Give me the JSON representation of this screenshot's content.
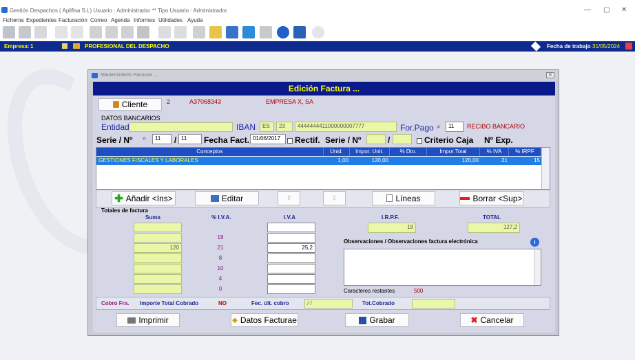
{
  "app": {
    "title": "Gestión Despachos  ( Aplifisa S.L)  Usuario : Administrador  **  Tipo Usuario : Administrador",
    "window_controls": [
      "—",
      "▢",
      "✕"
    ]
  },
  "menu": [
    "Ficheros",
    "Expedientes",
    "Facturación",
    "Correo",
    "Agenda",
    "Informes",
    "Utilidades",
    "Ayuda"
  ],
  "status": {
    "empresa_label": "Empresa:",
    "empresa_num": "1",
    "profesional": "PROFESIONAL DEL DESPACHO",
    "fecha_label": "Fecha de trabajo",
    "fecha_value": "31/05/2024"
  },
  "dialog": {
    "title": "Mantenimiento Facturas ...",
    "close": "✕",
    "header": "Edición Factura ..."
  },
  "cliente": {
    "button": "Cliente",
    "num": "2",
    "cif": "A37068343",
    "nombre": "EMPRESA X, SA"
  },
  "bank": {
    "section": "DATOS BANCARIOS",
    "entidad_label": "Entidad",
    "iban_label": "IBAN",
    "iban_country": "ES",
    "iban_check": "23",
    "iban_number": "4444444411000000007777",
    "forpago_label": "For.Pago",
    "forpago_code": "11",
    "forpago_desc": "RECIBO BANCARIO"
  },
  "serie": {
    "label": "Serie / Nº",
    "serie": "11",
    "num": "11",
    "fecha_label": "Fecha Fact.",
    "fecha": "01/06/2017",
    "rectif_label": "Rectif.",
    "serie2_label": "Serie / Nº",
    "criterio_label": "Criterio Caja",
    "nexp_label": "Nº Exp."
  },
  "table": {
    "headers": [
      "Conceptos",
      "Unid.",
      "Impor. Unit.",
      "% Dto.",
      "Impor.Total",
      "% IVA",
      "% IRPF"
    ],
    "rows": [
      {
        "concepto": "GESTIONES FISCALES Y LABORALES",
        "unid": "1,00",
        "unit": "120,00",
        "dto": "",
        "total": "120,00",
        "iva": "21",
        "irpf": "15"
      }
    ]
  },
  "buttons": {
    "anadir": "Añadir <Ins>",
    "editar": "Editar",
    "up": "⇧",
    "down": "⇩",
    "lineas": "Líneas",
    "borrar": "Borrar <Sup>",
    "imprimir": "Imprimir",
    "datos": "Datos Facturae",
    "grabar": "Grabar",
    "cancelar": "Cancelar"
  },
  "totales": {
    "title": "Totales de factura",
    "suma_label": "Suma",
    "iva_pct_label": "% I.V.A.",
    "iva_label": "I.V.A",
    "irpf_label": "I.R.P.F.",
    "irpf_value": "18",
    "total_label": "TOTAL",
    "total_value": "127,2",
    "rows": [
      {
        "suma": "",
        "pct": "",
        "iva": ""
      },
      {
        "suma": "",
        "pct": "18",
        "iva": ""
      },
      {
        "suma": "120",
        "pct": "21",
        "iva": "25,2"
      },
      {
        "suma": "",
        "pct": "8",
        "iva": ""
      },
      {
        "suma": "",
        "pct": "10",
        "iva": ""
      },
      {
        "suma": "",
        "pct": "4",
        "iva": ""
      },
      {
        "suma": "",
        "pct": "0",
        "iva": ""
      }
    ]
  },
  "obs": {
    "label": "Observaciones / Observaciones factura electrónica",
    "restantes_label": "Caracteres restantes",
    "restantes_value": "500"
  },
  "cobro": {
    "label": "Cobro Fra.",
    "importe_label": "Importe Total Cobrado",
    "importe_value": "NO",
    "fec_label": "Fec. últ. cobro",
    "fec_value": " /  /",
    "tot_label": "Tot.Cobrado"
  },
  "colors": {
    "header_bg": "#0a1a8a",
    "header_text": "#ffff00",
    "status_bg": "#0f2a8e",
    "table_header": "#1f4ec2",
    "row_selected": "#1f7ee8",
    "field_yellow": "#eaf7a6"
  }
}
